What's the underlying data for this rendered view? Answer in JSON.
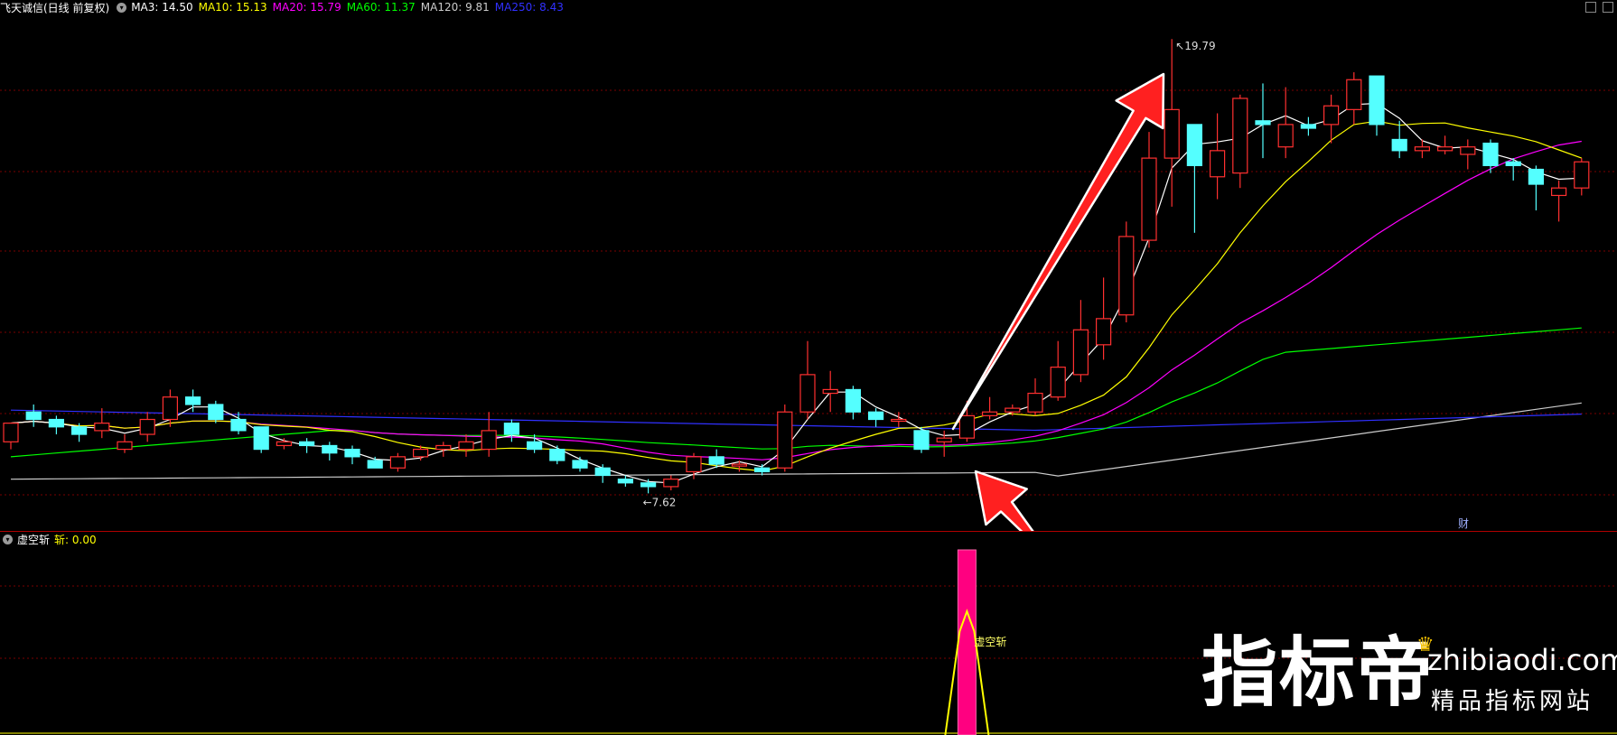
{
  "header": {
    "stock_title": "飞天诚信(日线 前复权)",
    "indicators": [
      {
        "label": "MA3: 14.50",
        "color": "#ffffff"
      },
      {
        "label": "MA10: 15.13",
        "color": "#ffff00"
      },
      {
        "label": "MA20: 15.79",
        "color": "#ff00ff"
      },
      {
        "label": "MA60: 11.37",
        "color": "#00ff00"
      },
      {
        "label": "MA120: 9.81",
        "color": "#cccccc"
      },
      {
        "label": "MA250: 8.43",
        "color": "#3030ff"
      }
    ]
  },
  "main_chart": {
    "high_label": "19.79",
    "low_label": "7.62",
    "fin_marker": "财"
  },
  "sub_chart": {
    "name": "虚空斩",
    "value_label": "斩: 0.00",
    "signal_text": "虚空斩"
  },
  "watermark": {
    "brand": "指标帝",
    "domain": "zhibiaodi.com",
    "slogan": "精品指标网站"
  },
  "colors": {
    "background": "#000000",
    "up_candle": "#ff3030",
    "down_candle": "#54ffff",
    "grid": "#7a0000",
    "divider": "#b00000",
    "signal_bar": "#ff0080",
    "signal_line": "#ffff00",
    "arrow": "#ff2020"
  },
  "chart_data": {
    "type": "candlestick",
    "price_range": [
      7.62,
      19.79
    ],
    "candles": [
      [
        9.0,
        9.5,
        8.8,
        9.2
      ],
      [
        9.8,
        9.6,
        9.4,
        10.0
      ],
      [
        9.6,
        9.4,
        9.2,
        9.7
      ],
      [
        9.4,
        9.2,
        9.0,
        9.5
      ],
      [
        9.3,
        9.5,
        9.1,
        9.9
      ],
      [
        8.8,
        9.0,
        8.7,
        9.2
      ],
      [
        9.2,
        9.6,
        9.0,
        9.8
      ],
      [
        9.6,
        10.2,
        9.4,
        10.4
      ],
      [
        10.2,
        10.0,
        9.8,
        10.4
      ],
      [
        10.0,
        9.6,
        9.5,
        10.1
      ],
      [
        9.6,
        9.3,
        9.2,
        9.8
      ],
      [
        9.4,
        8.8,
        8.7,
        9.4
      ],
      [
        8.9,
        9.0,
        8.8,
        9.1
      ],
      [
        9.0,
        8.9,
        8.7,
        9.1
      ],
      [
        8.9,
        8.7,
        8.5,
        9.0
      ],
      [
        8.8,
        8.6,
        8.4,
        8.9
      ],
      [
        8.5,
        8.3,
        8.3,
        8.6
      ],
      [
        8.3,
        8.6,
        8.2,
        8.7
      ],
      [
        8.6,
        8.8,
        8.5,
        8.9
      ],
      [
        8.8,
        8.9,
        8.6,
        9.0
      ],
      [
        8.8,
        9.0,
        8.6,
        9.2
      ],
      [
        8.8,
        9.3,
        8.6,
        9.8
      ],
      [
        9.5,
        9.2,
        9.0,
        9.6
      ],
      [
        9.0,
        8.8,
        8.7,
        9.2
      ],
      [
        8.8,
        8.5,
        8.4,
        8.9
      ],
      [
        8.5,
        8.3,
        8.2,
        8.6
      ],
      [
        8.3,
        8.1,
        7.9,
        8.4
      ],
      [
        8.0,
        7.9,
        7.8,
        8.1
      ],
      [
        7.9,
        7.8,
        7.62,
        8.0
      ],
      [
        7.8,
        8.0,
        7.7,
        8.1
      ],
      [
        8.2,
        8.6,
        8.0,
        8.7
      ],
      [
        8.6,
        8.4,
        8.3,
        8.8
      ],
      [
        8.4,
        8.4,
        8.2,
        8.5
      ],
      [
        8.3,
        8.2,
        8.1,
        8.4
      ],
      [
        8.3,
        9.8,
        8.2,
        10.0
      ],
      [
        9.8,
        10.8,
        9.6,
        11.7
      ],
      [
        10.3,
        10.4,
        9.8,
        10.9
      ],
      [
        10.4,
        9.8,
        9.6,
        10.5
      ],
      [
        9.8,
        9.6,
        9.4,
        9.9
      ],
      [
        9.6,
        9.6,
        9.4,
        9.8
      ],
      [
        9.3,
        8.8,
        8.7,
        9.4
      ],
      [
        9.0,
        9.1,
        8.6,
        9.3
      ],
      [
        9.1,
        9.7,
        9.0,
        10.1
      ],
      [
        9.7,
        9.8,
        9.6,
        10.2
      ],
      [
        9.8,
        9.9,
        9.7,
        10.0
      ],
      [
        9.8,
        10.3,
        9.7,
        10.7
      ],
      [
        10.2,
        11.0,
        10.1,
        11.7
      ],
      [
        10.8,
        12.0,
        10.6,
        12.8
      ],
      [
        11.6,
        12.3,
        11.2,
        13.4
      ],
      [
        12.4,
        14.5,
        12.2,
        14.9
      ],
      [
        14.4,
        16.6,
        14.2,
        17.3
      ],
      [
        16.6,
        17.9,
        15.3,
        19.79
      ],
      [
        17.5,
        16.4,
        14.6,
        17.5
      ],
      [
        16.1,
        16.8,
        15.5,
        17.8
      ],
      [
        16.2,
        18.2,
        15.8,
        18.3
      ],
      [
        17.6,
        17.5,
        16.6,
        18.6
      ],
      [
        16.9,
        17.5,
        16.6,
        18.5
      ],
      [
        17.5,
        17.4,
        17.2,
        17.7
      ],
      [
        17.5,
        18.0,
        17.0,
        18.3
      ],
      [
        17.9,
        18.7,
        17.5,
        18.9
      ],
      [
        18.8,
        17.5,
        17.2,
        18.8
      ],
      [
        17.1,
        16.8,
        16.6,
        17.6
      ],
      [
        16.8,
        16.9,
        16.6,
        17.1
      ],
      [
        16.8,
        16.9,
        16.7,
        17.2
      ],
      [
        16.7,
        16.9,
        16.3,
        17.1
      ],
      [
        17.0,
        16.4,
        16.2,
        17.1
      ],
      [
        16.5,
        16.4,
        16.0,
        16.6
      ],
      [
        16.3,
        15.9,
        15.2,
        16.4
      ],
      [
        15.6,
        15.8,
        14.9,
        16.0
      ],
      [
        15.8,
        16.5,
        15.6,
        16.6
      ]
    ],
    "signal_index": 42
  }
}
